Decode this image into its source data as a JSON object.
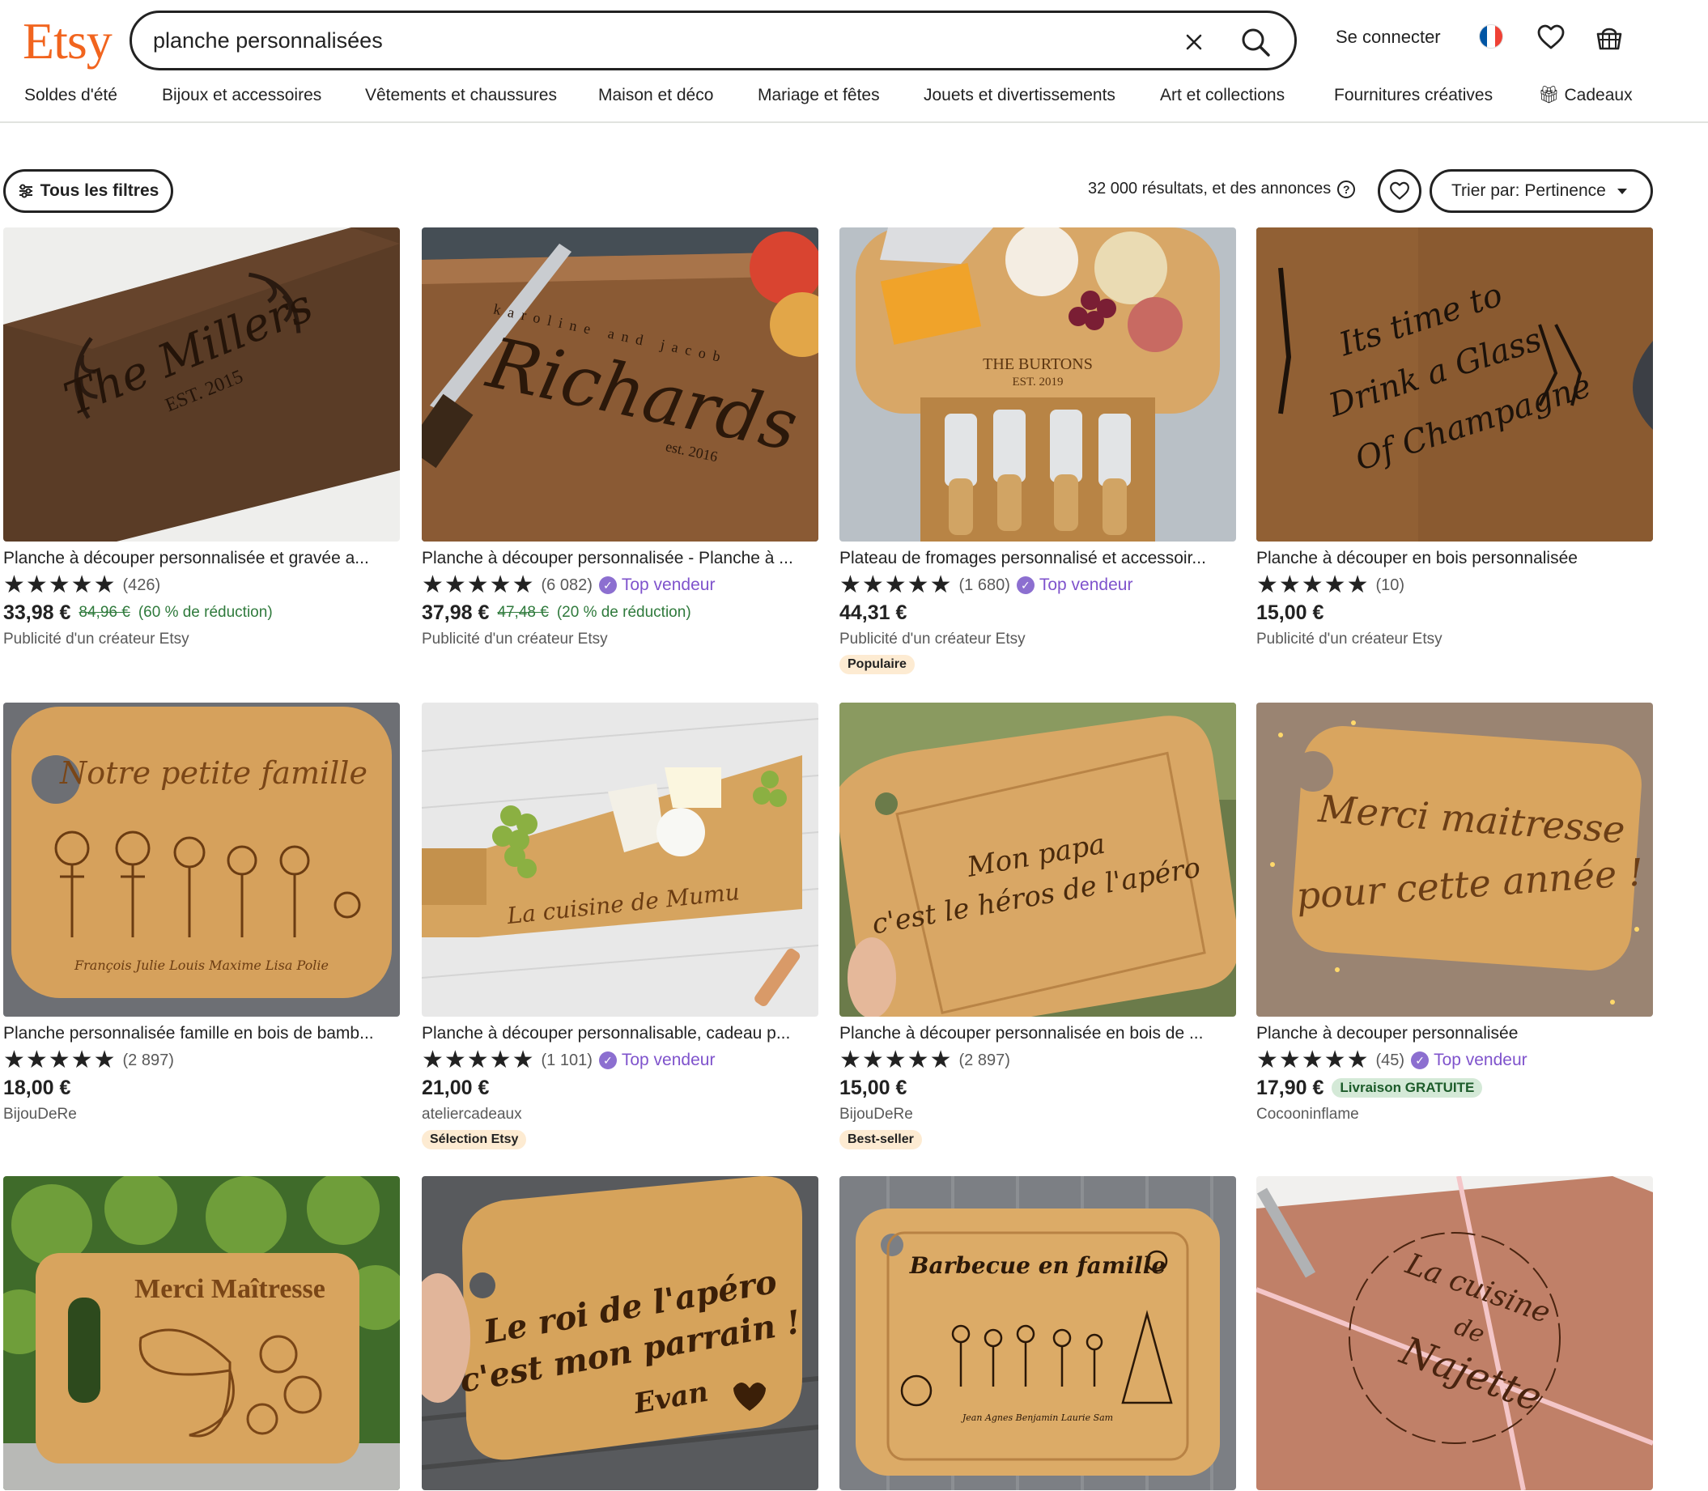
{
  "header": {
    "logo": "Etsy",
    "search_value": "planche personnalisées",
    "signin": "Se connecter",
    "icons": [
      "clear-icon",
      "search-icon",
      "flag-fr-icon",
      "heart-icon",
      "basket-icon"
    ]
  },
  "nav": [
    "Soldes d'été",
    "Bijoux et accessoires",
    "Vêtements et chaussures",
    "Maison et déco",
    "Mariage et fêtes",
    "Jouets et divertissements",
    "Art et collections",
    "Fournitures créatives",
    "Cadeaux"
  ],
  "toolbar": {
    "filters_label": "Tous les filtres",
    "results": "32 000 résultats, et des annonces",
    "sort_label": "Trier par:",
    "sort_value": "Pertinence"
  },
  "colors": {
    "brand": "#f1641e",
    "top_seller": "#7f53cc",
    "discount": "#2f7a3c"
  },
  "listings": [
    {
      "title": "Planche à découper personnalisée et gravée a...",
      "stars": "★★★★★",
      "reviews": "(426)",
      "top": "",
      "price": "33,98 €",
      "old_price": "84,96 €",
      "discount": "(60 % de réduction)",
      "free": "",
      "seller": "Publicité d'un créateur Etsy",
      "badge": "",
      "engraving": [
        "The Millers",
        "EST. 2015"
      ]
    },
    {
      "title": "Planche à découper personnalisée - Planche à ...",
      "stars": "★★★★★",
      "reviews": "(6 082)",
      "top": "Top vendeur",
      "price": "37,98 €",
      "old_price": "47,48 €",
      "discount": "(20 % de réduction)",
      "free": "",
      "seller": "Publicité d'un créateur Etsy",
      "badge": "",
      "engraving": [
        "karoline and jacob",
        "Richards",
        "est. 2016"
      ]
    },
    {
      "title": "Plateau de fromages personnalisé et accessoir...",
      "stars": "★★★★★",
      "reviews": "(1 680)",
      "top": "Top vendeur",
      "price": "44,31 €",
      "old_price": "",
      "discount": "",
      "free": "",
      "seller": "Publicité d'un créateur Etsy",
      "badge": "Populaire",
      "engraving": [
        "THE BURTONS",
        "EST. 2019"
      ]
    },
    {
      "title": "Planche à découper en bois personnalisée",
      "stars": "★★★★★",
      "reviews": "(10)",
      "top": "",
      "price": "15,00 €",
      "old_price": "",
      "discount": "",
      "free": "",
      "seller": "Publicité d'un créateur Etsy",
      "badge": "",
      "engraving": [
        "Its time to",
        "Drink a Glass",
        "Of Champagne"
      ]
    },
    {
      "title": "Planche personnalisée famille en bois de bamb...",
      "stars": "★★★★★",
      "reviews": "(2 897)",
      "top": "",
      "price": "18,00 €",
      "old_price": "",
      "discount": "",
      "free": "",
      "seller": "BijouDeRe",
      "badge": "",
      "engraving": [
        "Notre petite famille",
        "François  Julie  Louis  Maxime  Lisa  Polie"
      ]
    },
    {
      "title": "Planche à découper personnalisable, cadeau p...",
      "stars": "★★★★★",
      "reviews": "(1 101)",
      "top": "Top vendeur",
      "price": "21,00 €",
      "old_price": "",
      "discount": "",
      "free": "",
      "seller": "ateliercadeaux",
      "badge": "Sélection Etsy",
      "engraving": [
        "La cuisine de Mumu"
      ]
    },
    {
      "title": "Planche à découper personnalisée en bois de ...",
      "stars": "★★★★★",
      "reviews": "(2 897)",
      "top": "",
      "price": "15,00 €",
      "old_price": "",
      "discount": "",
      "free": "",
      "seller": "BijouDeRe",
      "badge": "Best-seller",
      "engraving": [
        "Mon papa",
        "c'est le héros de l'apéro"
      ]
    },
    {
      "title": "Planche à decouper personnalisée",
      "stars": "★★★★★",
      "reviews": "(45)",
      "top": "Top vendeur",
      "price": "17,90 €",
      "old_price": "",
      "discount": "",
      "free": "Livraison GRATUITE",
      "seller": "Cocooninflame",
      "badge": "",
      "engraving": [
        "Merci maitresse",
        "pour cette année !"
      ]
    },
    {
      "engraving": [
        "Merci Maîtresse"
      ]
    },
    {
      "engraving": [
        "Le roi de l'apéro",
        "c'est mon parrain !",
        "Evan"
      ]
    },
    {
      "engraving": [
        "Barbecue en famille",
        "Jean  Agnes  Benjamin  Laurie  Sam"
      ]
    },
    {
      "engraving": [
        "La cuisine",
        "de",
        "Najette"
      ]
    }
  ]
}
